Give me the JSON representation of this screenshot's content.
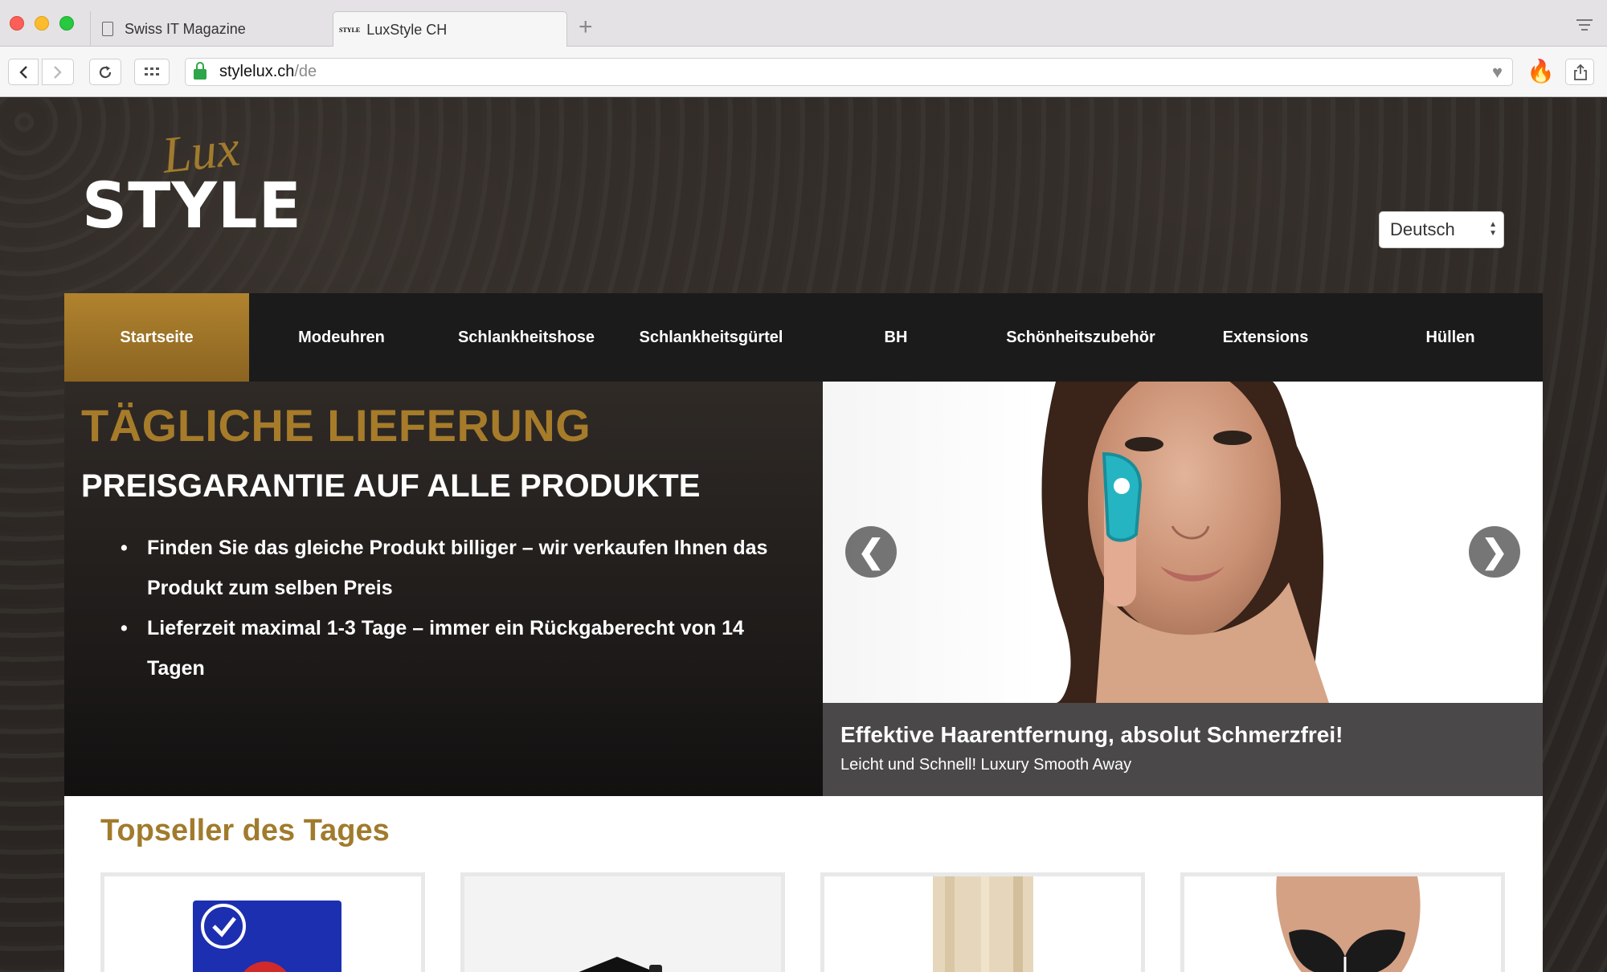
{
  "browser": {
    "tabs": [
      {
        "label": "Swiss IT Magazine",
        "active": false
      },
      {
        "label": "LuxStyle CH",
        "active": true,
        "favicon_text": "STYLE"
      }
    ],
    "url_host": "stylelux.ch",
    "url_path": "/de"
  },
  "site": {
    "logo": {
      "script": "Lux",
      "word": "STYLE"
    },
    "language_select": {
      "selected": "Deutsch"
    },
    "nav": [
      {
        "label": "Startseite",
        "active": true
      },
      {
        "label": "Modeuhren"
      },
      {
        "label": "Schlankheitshose"
      },
      {
        "label": "Schlankheitsgürtel"
      },
      {
        "label": "BH"
      },
      {
        "label": "Schönheitszubehör"
      },
      {
        "label": "Extensions"
      },
      {
        "label": "Hüllen"
      }
    ],
    "hero": {
      "heading": "TÄGLICHE LIEFERUNG",
      "subheading": "PREISGARANTIE AUF ALLE PRODUKTE",
      "bullets": [
        "Finden Sie das gleiche Produkt billiger – wir verkaufen Ihnen das Produkt zum selben Preis",
        "Lieferzeit maximal 1-3 Tage – immer ein Rückgaberecht von 14 Tagen"
      ]
    },
    "slider": {
      "prev": "❮",
      "next": "❯",
      "caption_title": "Effektive Haarentfernung, absolut Schmerzfrei!",
      "caption_subtitle": "Leicht und Schnell! Luxury Smooth Away"
    },
    "topseller": {
      "title": "Topseller des Tages"
    }
  },
  "colors": {
    "accent_gold": "#a67b2a",
    "nav_bg": "#1c1b1b",
    "caption_bg": "#4a4848"
  }
}
